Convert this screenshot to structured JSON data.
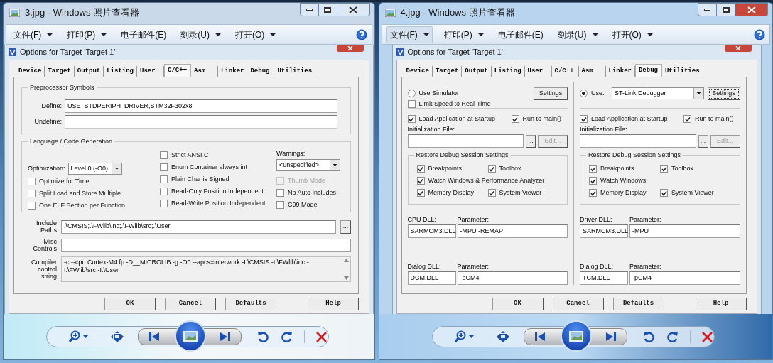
{
  "windows": [
    {
      "title": "3.jpg - Windows 照片查看器",
      "active": false,
      "menu": [
        {
          "label": "文件(F)",
          "dropdown": true,
          "selected": false
        },
        {
          "label": "打印(P)",
          "dropdown": true,
          "selected": false
        },
        {
          "label": "电子邮件(E)",
          "dropdown": false,
          "selected": false
        },
        {
          "label": "刻录(U)",
          "dropdown": true,
          "selected": false
        },
        {
          "label": "打开(O)",
          "dropdown": true,
          "selected": false
        }
      ],
      "dialog": {
        "title": "Options for Target 'Target 1'",
        "kind": "cc",
        "tabs": [
          {
            "label": "Device",
            "selected": false
          },
          {
            "label": "Target",
            "selected": false
          },
          {
            "label": "Output",
            "selected": false
          },
          {
            "label": "Listing",
            "selected": false
          },
          {
            "label": "User",
            "selected": false
          },
          {
            "label": "C/C++",
            "selected": true
          },
          {
            "label": "Asm",
            "selected": false
          },
          {
            "label": "Linker",
            "selected": false
          },
          {
            "label": "Debug",
            "selected": false
          },
          {
            "label": "Utilities",
            "selected": false
          }
        ],
        "cc": {
          "preprocessor": {
            "legend": "Preprocessor Symbols",
            "fields": [
              {
                "label": "Define:",
                "value": "USE_STDPERIPH_DRIVER,STM32F302x8",
                "disabled": false
              },
              {
                "label": "Undefine:",
                "disabled": true
              }
            ]
          },
          "language": {
            "legend": "Language / Code Generation",
            "optimization": {
              "label": "Optimization:",
              "value": "Level 0 (-O0)"
            },
            "options_left": [
              {
                "label": "Optimize for Time",
                "checked": false
              },
              {
                "label": "Split Load and Store Multiple",
                "checked": false
              },
              {
                "label": "One ELF Section per Function",
                "checked": false
              }
            ],
            "options_middle": [
              {
                "label": "Strict ANSI C",
                "checked": false
              },
              {
                "label": "Enum Container always int",
                "checked": false
              },
              {
                "label": "Plain Char is Signed",
                "checked": false
              },
              {
                "label": "Read-Only Position Independent",
                "checked": false
              },
              {
                "label": "Read-Write Position Independent",
                "checked": false
              }
            ],
            "warnings": {
              "label": "Warnings:",
              "value": "<unspecified>"
            },
            "options_right": [
              {
                "label": "Thumb Mode",
                "checked": false,
                "disabled": true
              },
              {
                "label": "No Auto Includes",
                "checked": false,
                "disabled": false
              },
              {
                "label": "C99 Mode",
                "checked": false,
                "disabled": false
              }
            ]
          },
          "fields": [
            {
              "kind": "path",
              "label": "Include Paths",
              "value": ".\\CMSIS;.\\FWlib\\inc;.\\FWlib\\src;.\\User",
              "browse": "..."
            },
            {
              "kind": "text",
              "label": "Misc Controls"
            },
            {
              "kind": "multiline",
              "label": "Compiler control string",
              "value": "-c --cpu Cortex-M4.fp -D__MICROLIB -g -O0 --apcs=interwork -I.\\CMSIS -I.\\FWlib\\inc -I.\\FWlib\\src -I.\\User"
            }
          ]
        },
        "buttons": [
          "OK",
          "Cancel",
          "Defaults",
          "Help"
        ]
      }
    },
    {
      "title": "4.jpg - Windows 照片查看器",
      "active": true,
      "menu": [
        {
          "label": "文件(F)",
          "dropdown": true,
          "selected": true
        },
        {
          "label": "打印(P)",
          "dropdown": true,
          "selected": false
        },
        {
          "label": "电子邮件(E)",
          "dropdown": false,
          "selected": false
        },
        {
          "label": "刻录(U)",
          "dropdown": true,
          "selected": false
        },
        {
          "label": "打开(O)",
          "dropdown": true,
          "selected": false
        }
      ],
      "dialog": {
        "title": "Options for Target 'Target 1'",
        "kind": "debug",
        "tabs": [
          {
            "label": "Device",
            "selected": false
          },
          {
            "label": "Target",
            "selected": false
          },
          {
            "label": "Output",
            "selected": false
          },
          {
            "label": "Listing",
            "selected": false
          },
          {
            "label": "User",
            "selected": false
          },
          {
            "label": "C/C++",
            "selected": false
          },
          {
            "label": "Asm",
            "selected": false
          },
          {
            "label": "Linker",
            "selected": false
          },
          {
            "label": "Debug",
            "selected": true
          },
          {
            "label": "Utilities",
            "selected": false
          }
        ],
        "debug": {
          "sides": [
            {
              "mode": {
                "kind": "simulator",
                "label": "Use Simulator",
                "selected": false
              },
              "settings": "Settings",
              "limit": {
                "label": "Limit Speed to Real-Time",
                "checked": false
              },
              "load": {
                "label": "Load Application at Startup",
                "checked": true
              },
              "run": {
                "label": "Run to main()",
                "checked": true
              },
              "init_label": "Initialization File:",
              "browse": "...",
              "edit": "Edit...",
              "restore": {
                "legend": "Restore Debug Session Settings",
                "items": [
                  {
                    "label": "Breakpoints",
                    "checked": true
                  },
                  {
                    "label": "Toolbox",
                    "checked": true
                  },
                  {
                    "label": "Watch Windows & Performance Analyzer",
                    "checked": true
                  },
                  {
                    "label": "Memory Display",
                    "checked": true
                  },
                  {
                    "label": "System Viewer",
                    "checked": true
                  }
                ]
              },
              "dlls": [
                {
                  "label": "CPU DLL:",
                  "value": "SARMCM3.DLL",
                  "param_label": "Parameter:",
                  "param": "-MPU -REMAP"
                },
                {
                  "label": "Dialog DLL:",
                  "value": "DCM.DLL",
                  "param_label": "Parameter:",
                  "param": "-pCM4"
                }
              ]
            },
            {
              "mode": {
                "kind": "target",
                "label": "Use:",
                "selected": true,
                "value": "ST-Link Debugger"
              },
              "settings": "Settings",
              "load": {
                "label": "Load Application at Startup",
                "checked": true
              },
              "run": {
                "label": "Run to main()",
                "checked": true
              },
              "init_label": "Initialization File:",
              "browse": "...",
              "edit": "Edit...",
              "restore": {
                "legend": "Restore Debug Session Settings",
                "items": [
                  {
                    "label": "Breakpoints",
                    "checked": true
                  },
                  {
                    "label": "Toolbox",
                    "checked": true
                  },
                  {
                    "label": "Watch Windows",
                    "checked": true
                  },
                  {
                    "label": "Memory Display",
                    "checked": true
                  },
                  {
                    "label": "System Viewer",
                    "checked": true
                  }
                ]
              },
              "dlls": [
                {
                  "label": "Driver DLL:",
                  "value": "SARMCM3.DLL",
                  "param_label": "Parameter:",
                  "param": "-MPU"
                },
                {
                  "label": "Dialog DLL:",
                  "value": "TCM.DLL",
                  "param_label": "Parameter:",
                  "param": "-pCM4"
                }
              ]
            }
          ]
        },
        "buttons": [
          "OK",
          "Cancel",
          "Defaults",
          "Help"
        ]
      }
    }
  ]
}
